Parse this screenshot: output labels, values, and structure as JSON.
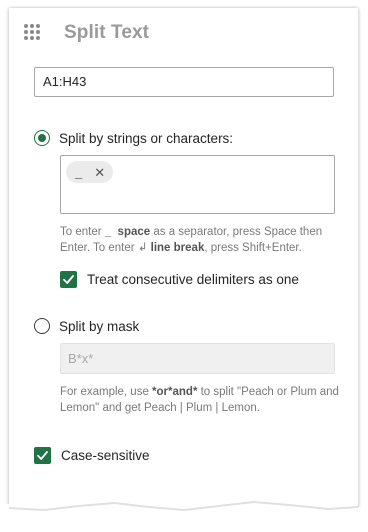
{
  "panel": {
    "title": "Split Text",
    "grip_icon": "drag-grip-icon"
  },
  "range": {
    "value": "A1:H43"
  },
  "split_by_strings": {
    "label": "Split by strings or characters:",
    "selected": true,
    "chips": [
      {
        "text": "_",
        "remove_icon": "close-icon"
      }
    ],
    "hint_part1": "To enter ",
    "hint_space_symbol": "_",
    "hint_space_word": "space",
    "hint_part2": " as a separator, press Space then Enter. To enter ",
    "hint_break_symbol": "↲",
    "hint_break_word": "line break",
    "hint_part3": ", press Shift+Enter."
  },
  "treat_consecutive": {
    "label": "Treat consecutive delimiters as one",
    "checked": true
  },
  "split_by_mask": {
    "label": "Split by mask",
    "selected": false,
    "placeholder": "B*x*",
    "hint_part1": "For example, use ",
    "hint_example": "*or*and*",
    "hint_part2": " to split \"Peach or Plum and Lemon\" and get Peach | Plum | Lemon."
  },
  "case_sensitive": {
    "label": "Case-sensitive",
    "checked": true
  },
  "colors": {
    "accent": "#217346",
    "title": "#9a9a9a",
    "hint": "#7a7a7a",
    "border": "#a8a8a8",
    "disabled_bg": "#f0f0f0"
  }
}
